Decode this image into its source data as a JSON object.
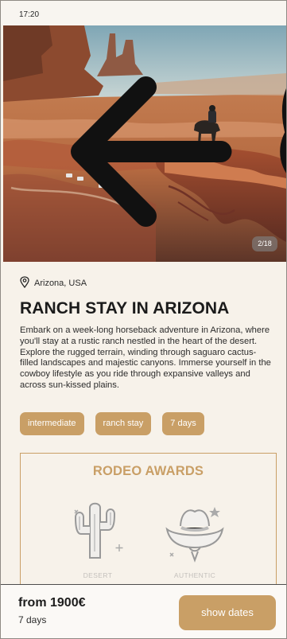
{
  "status_bar": {
    "time": "17:20"
  },
  "hero": {
    "image_counter": "2/18",
    "icons": {
      "back": "arrow-left-icon",
      "share": "share-icon",
      "favorite": "heart-icon"
    }
  },
  "trip": {
    "location": "Arizona, USA",
    "title": "RANCH STAY IN ARIZONA",
    "description": "Embark on a week-long horseback adventure in Arizona, where you'll stay at a rustic ranch nestled in the heart of the desert. Explore the rugged terrain, winding through saguaro cactus-filled landscapes and majestic canyons. Immerse yourself in the cowboy lifestyle as you ride through expansive valleys and across sun-kissed plains.",
    "tags": [
      "intermediate",
      "ranch stay",
      "7 days"
    ]
  },
  "awards": {
    "title": "RODEO AWARDS",
    "items": [
      {
        "label": "DESERT",
        "icon": "cactus-icon"
      },
      {
        "label": "AUTHENTIC",
        "icon": "cowboy-hat-icon"
      }
    ]
  },
  "booking": {
    "price": "from 1900€",
    "duration": "7 days",
    "button": "show dates"
  },
  "colors": {
    "accent": "#c99f66",
    "background": "#f7f2ea",
    "text": "#1b1b1b"
  }
}
